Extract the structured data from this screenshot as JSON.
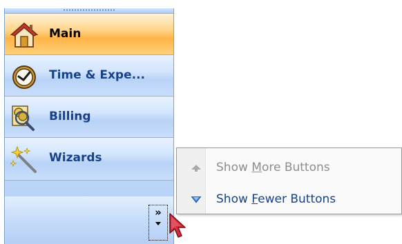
{
  "navigation_pane": {
    "items": [
      {
        "label": "Main",
        "icon": "house-icon",
        "active": true
      },
      {
        "label": "Time & Expe...",
        "icon": "clock-icon",
        "active": false
      },
      {
        "label": "Billing",
        "icon": "coins-magnifier-icon",
        "active": false
      },
      {
        "label": "Wizards",
        "icon": "magic-wand-icon",
        "active": false
      }
    ],
    "overflow_button": {
      "glyph": "»",
      "icon": "chevron-double-right-icon"
    }
  },
  "context_menu": {
    "items": [
      {
        "label_before": "Show ",
        "mnemonic": "M",
        "label_after": "ore Buttons",
        "icon": "arrow-up-icon",
        "enabled": false
      },
      {
        "label_before": "Show ",
        "mnemonic": "F",
        "label_after": "ewer Buttons",
        "icon": "arrow-down-icon",
        "enabled": true
      }
    ]
  },
  "colors": {
    "active_item": "#ffb447",
    "pane_blue": "#c4dcfb",
    "label_blue": "#15428b",
    "disabled_text": "#8d8d8d",
    "cursor_red": "#c8102e"
  }
}
